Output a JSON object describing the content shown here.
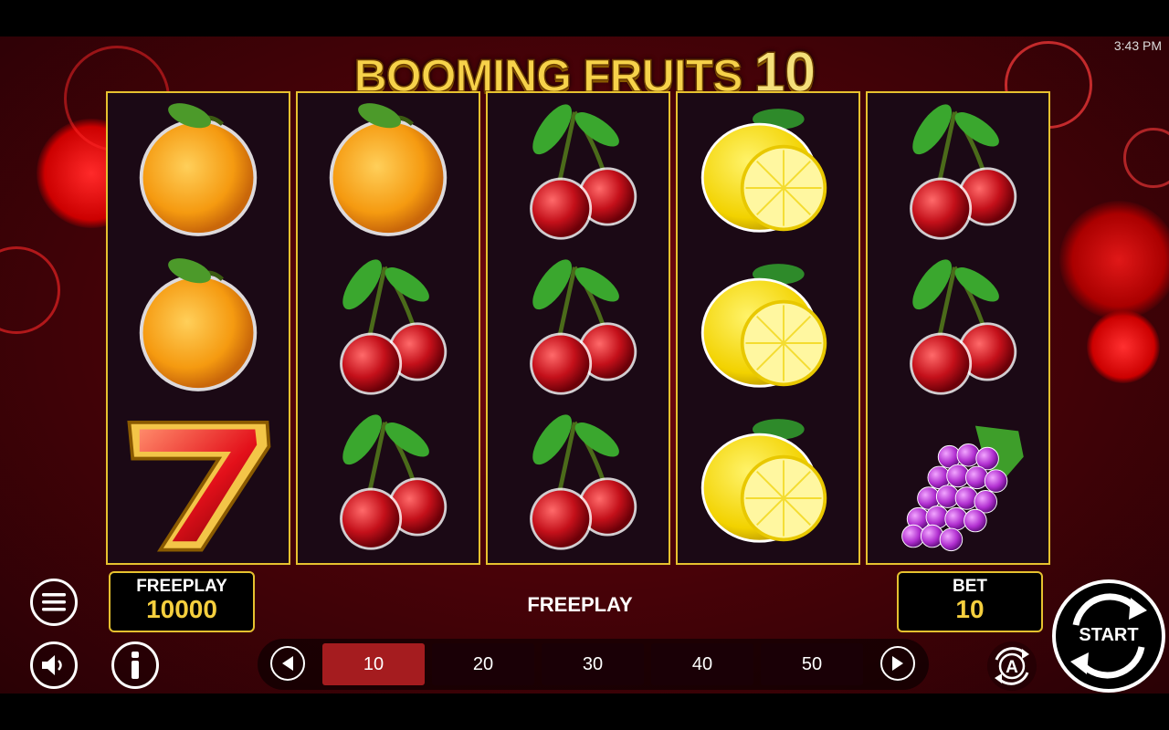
{
  "status_bar": {
    "time": "3:43 PM"
  },
  "game": {
    "title_main": "BOOMING FRUITS",
    "title_number": "10"
  },
  "reels": [
    [
      "orange",
      "orange",
      "seven"
    ],
    [
      "orange",
      "cherry",
      "cherry"
    ],
    [
      "cherry",
      "cherry",
      "cherry"
    ],
    [
      "lemon",
      "lemon",
      "lemon"
    ],
    [
      "cherry",
      "cherry",
      "grapes"
    ]
  ],
  "hud": {
    "balance_label": "FREEPLAY",
    "balance_value": "10000",
    "mode_label": "FREEPLAY",
    "bet_label": "BET",
    "bet_value": "10",
    "start_label": "START"
  },
  "bet_options": [
    "10",
    "20",
    "30",
    "40",
    "50"
  ],
  "selected_bet": "10",
  "icons": {
    "menu": "hamburger-menu-icon",
    "sound": "speaker-icon",
    "info": "info-icon",
    "prev": "triangle-left-icon",
    "next": "triangle-right-icon",
    "autoplay": "autoplay-icon",
    "start": "refresh-arrows-icon"
  },
  "colors": {
    "frame_gold": "#e6c12f",
    "selected_bet": "#a51c1f",
    "value_gold": "#f5cf3e"
  }
}
